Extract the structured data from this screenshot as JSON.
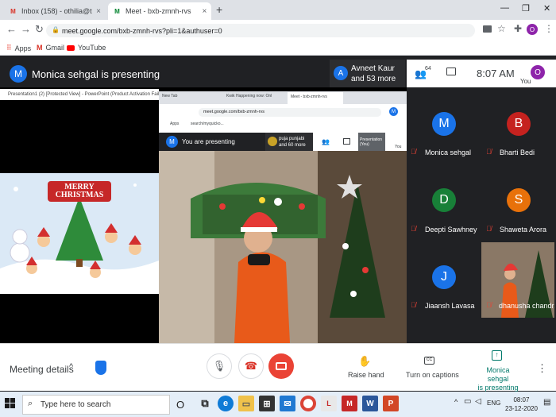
{
  "browser": {
    "tabs": [
      {
        "label": "Inbox (158) - othilia@theindians",
        "favicon": "M",
        "favicon_color": "#d93025"
      },
      {
        "label": "Meet - bxb-zmnh-rvs",
        "favicon": "M",
        "favicon_color": "#00832d"
      }
    ],
    "new_tab": "+",
    "url": "meet.google.com/bxb-zmnh-rvs?pli=1&authuser=0",
    "profile_initial": "O",
    "bookmarks": [
      {
        "label": "Apps"
      },
      {
        "label": "Gmail"
      },
      {
        "label": "YouTube"
      }
    ]
  },
  "meet": {
    "presenter_initial": "M",
    "presenting_text": "Monica sehgal is presenting",
    "others_initial": "A",
    "others_line1": "Avneet Kaur",
    "others_line2": "and 53 more",
    "participant_count": "64",
    "clock": "8:07 AM",
    "you_label": "You",
    "you_initial": "O",
    "tiles": [
      {
        "initial": "M",
        "name": "Monica sehgal",
        "color": "#1a73e8"
      },
      {
        "initial": "B",
        "name": "Bharti Bedi",
        "color": "#c5221f"
      },
      {
        "initial": "D",
        "name": "Deepti Sawhney",
        "color": "#188038"
      },
      {
        "initial": "S",
        "name": "Shaweta Arora",
        "color": "#e8710a"
      },
      {
        "initial": "J",
        "name": "Jiaansh Lavasa",
        "color": "#1a73e8"
      },
      {
        "initial": "",
        "name": "dhanusha chandr...",
        "color": ""
      }
    ],
    "controls": {
      "meeting_details": "Meeting details",
      "raise_hand": "Raise hand",
      "captions": "Turn on captions",
      "presenting_line1": "Monica sehgal",
      "presenting_line2": "is presenting"
    }
  },
  "shared": {
    "ppt_title": "Presentation1 (2) [Protected View] - PowerPoint (Product Activation Failed)",
    "slide_text": "MERRY CHRISTMAS",
    "inner_tabs": [
      "New Tab",
      "Kwik Happening now: Onl",
      "Meet - bxb-zmnh-rvs"
    ],
    "inner_url": "meet.google.com/bxb-zmnh-rvs",
    "inner_apps": "Apps",
    "inner_search": "search/myquicko...",
    "inner_presenting": "You are presenting",
    "inner_presenter_initial": "M",
    "inner_others_line1": "puja punjabi",
    "inner_others_line2": "and 60 more",
    "inner_tile_label": "Presentation",
    "inner_tile_sub": "(You)",
    "inner_you": "You"
  },
  "taskbar": {
    "search_placeholder": "Type here to search",
    "lang": "ENG",
    "time": "08:07",
    "date": "23-12-2020"
  }
}
